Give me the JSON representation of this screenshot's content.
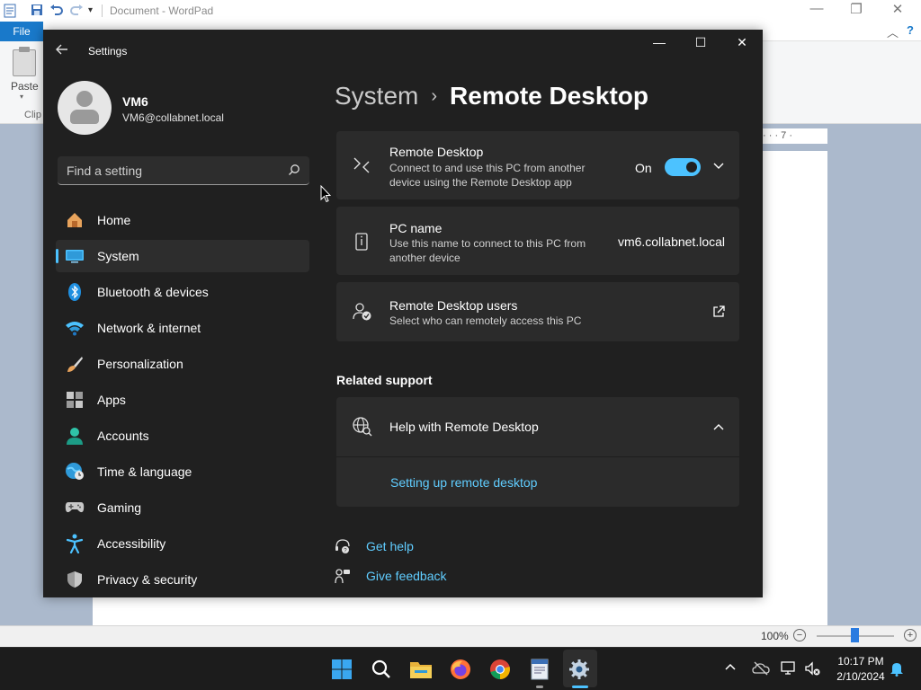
{
  "wordpad": {
    "title": "Document - WordPad",
    "file_tab": "File",
    "paste_label": "Paste",
    "clipboard_label": "Clip",
    "ruler_text": "· · · 7 ·",
    "zoom_level": "100%",
    "zoom_level_value": 0.5
  },
  "settings": {
    "window_title": "Settings",
    "user": {
      "name": "VM6",
      "email": "VM6@collabnet.local"
    },
    "search_placeholder": "Find a setting",
    "nav": [
      {
        "label": "Home",
        "icon": "home-icon",
        "active": false
      },
      {
        "label": "System",
        "icon": "system-icon",
        "active": true
      },
      {
        "label": "Bluetooth & devices",
        "icon": "bluetooth-icon",
        "active": false
      },
      {
        "label": "Network & internet",
        "icon": "wifi-icon",
        "active": false
      },
      {
        "label": "Personalization",
        "icon": "brush-icon",
        "active": false
      },
      {
        "label": "Apps",
        "icon": "apps-icon",
        "active": false
      },
      {
        "label": "Accounts",
        "icon": "accounts-icon",
        "active": false
      },
      {
        "label": "Time & language",
        "icon": "globe-clock-icon",
        "active": false
      },
      {
        "label": "Gaming",
        "icon": "gamepad-icon",
        "active": false
      },
      {
        "label": "Accessibility",
        "icon": "accessibility-icon",
        "active": false
      },
      {
        "label": "Privacy & security",
        "icon": "shield-icon",
        "active": false
      }
    ],
    "breadcrumb": {
      "parent": "System",
      "separator": "›",
      "current": "Remote Desktop"
    },
    "remote_desktop": {
      "title": "Remote Desktop",
      "description": "Connect to and use this PC from another device using the Remote Desktop app",
      "state_label": "On",
      "enabled": true
    },
    "pc_name": {
      "title": "PC name",
      "description": "Use this name to connect to this PC from another device",
      "value": "vm6.collabnet.local"
    },
    "rd_users": {
      "title": "Remote Desktop users",
      "description": "Select who can remotely access this PC"
    },
    "related_support": {
      "heading": "Related support",
      "help_title": "Help with Remote Desktop",
      "link": "Setting up remote desktop"
    },
    "footer": {
      "get_help": "Get help",
      "give_feedback": "Give feedback"
    },
    "colors": {
      "accent": "#4cc2ff",
      "link": "#60cdff",
      "background": "#202020",
      "card": "#2b2b2b"
    }
  },
  "taskbar": {
    "time": "10:17 PM",
    "date": "2/10/2024",
    "apps": [
      "start-icon",
      "search-icon",
      "file-explorer-icon",
      "firefox-icon",
      "chrome-icon",
      "wordpad-icon",
      "settings-icon"
    ]
  }
}
